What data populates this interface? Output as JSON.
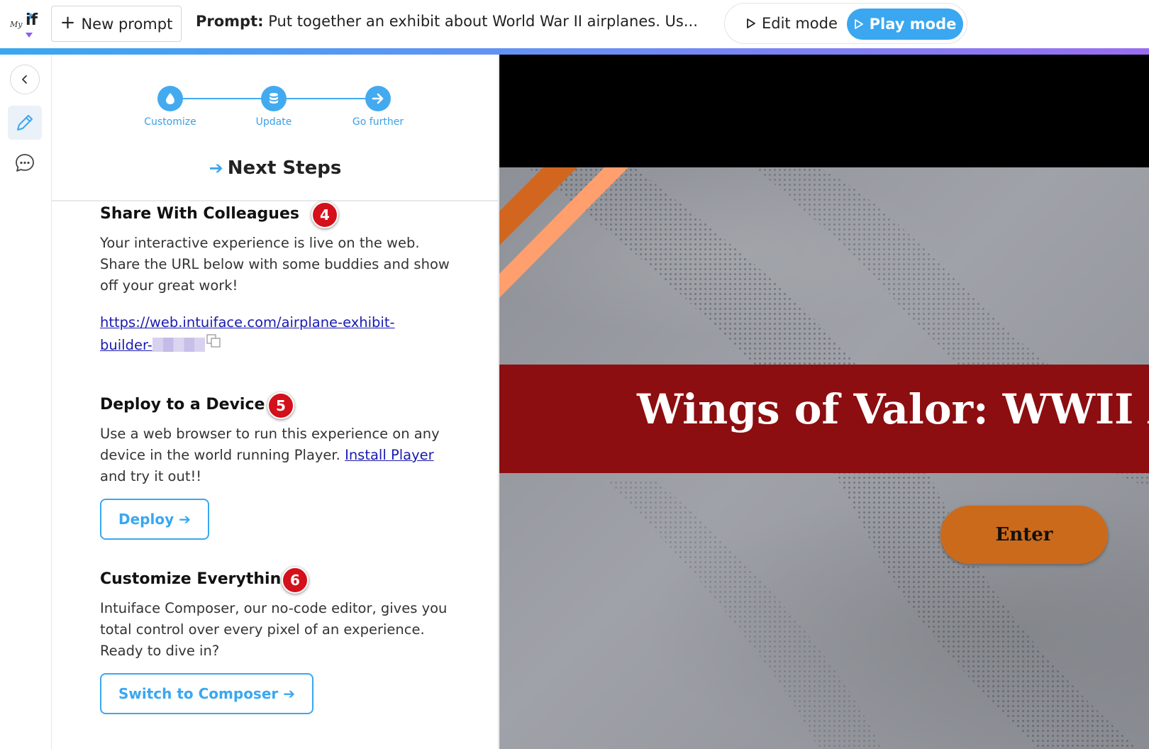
{
  "topbar": {
    "logo_my": "My",
    "logo_if": "if",
    "new_prompt_label": "New prompt",
    "prompt_prefix": "Prompt:",
    "prompt_text": "Put together an exhibit about World War II airplanes. Us...",
    "edit_mode_label": "Edit mode",
    "play_mode_label": "Play mode",
    "active_mode": "Play mode"
  },
  "colors": {
    "accent": "#3aa7f0",
    "badge": "#d4101a",
    "banner": "#8c0e10",
    "enter_button": "#cc6a1b",
    "stripe_dark": "#d2661f",
    "stripe_light": "#ff9f6e"
  },
  "rail": {
    "icons": [
      "chevron-left-icon",
      "pencil-icon",
      "chat-bubble-icon"
    ]
  },
  "stepper": {
    "steps": [
      {
        "label": "Customize",
        "icon": "water-drop-icon"
      },
      {
        "label": "Update",
        "icon": "database-icon"
      },
      {
        "label": "Go further",
        "icon": "arrow-right-icon"
      }
    ]
  },
  "panel": {
    "title": "Next Steps",
    "sections": [
      {
        "badge": "4",
        "heading": "Share With Colleagues",
        "body": "Your interactive experience is live on the web. Share the URL below with some buddies and show off your great work!",
        "url_line1": "https://web.intuiface.com/airplane-exhibit-",
        "url_line2": "builder-"
      },
      {
        "badge": "5",
        "heading": "Deploy to a Device",
        "body_before": "Use a web browser to run this experience on any device in the world running Player.",
        "link": "Install Player",
        "body_after": "and try it out!!",
        "button": "Deploy ➔"
      },
      {
        "badge": "6",
        "heading": "Customize Everything",
        "body": "Intuiface Composer, our no-code editor, gives you total control over every pixel of an experience. Ready to dive in?",
        "button": "Switch to Composer ➔"
      }
    ]
  },
  "preview": {
    "banner_title": "Wings of Valor: WWII Air M",
    "enter_label": "Enter"
  }
}
